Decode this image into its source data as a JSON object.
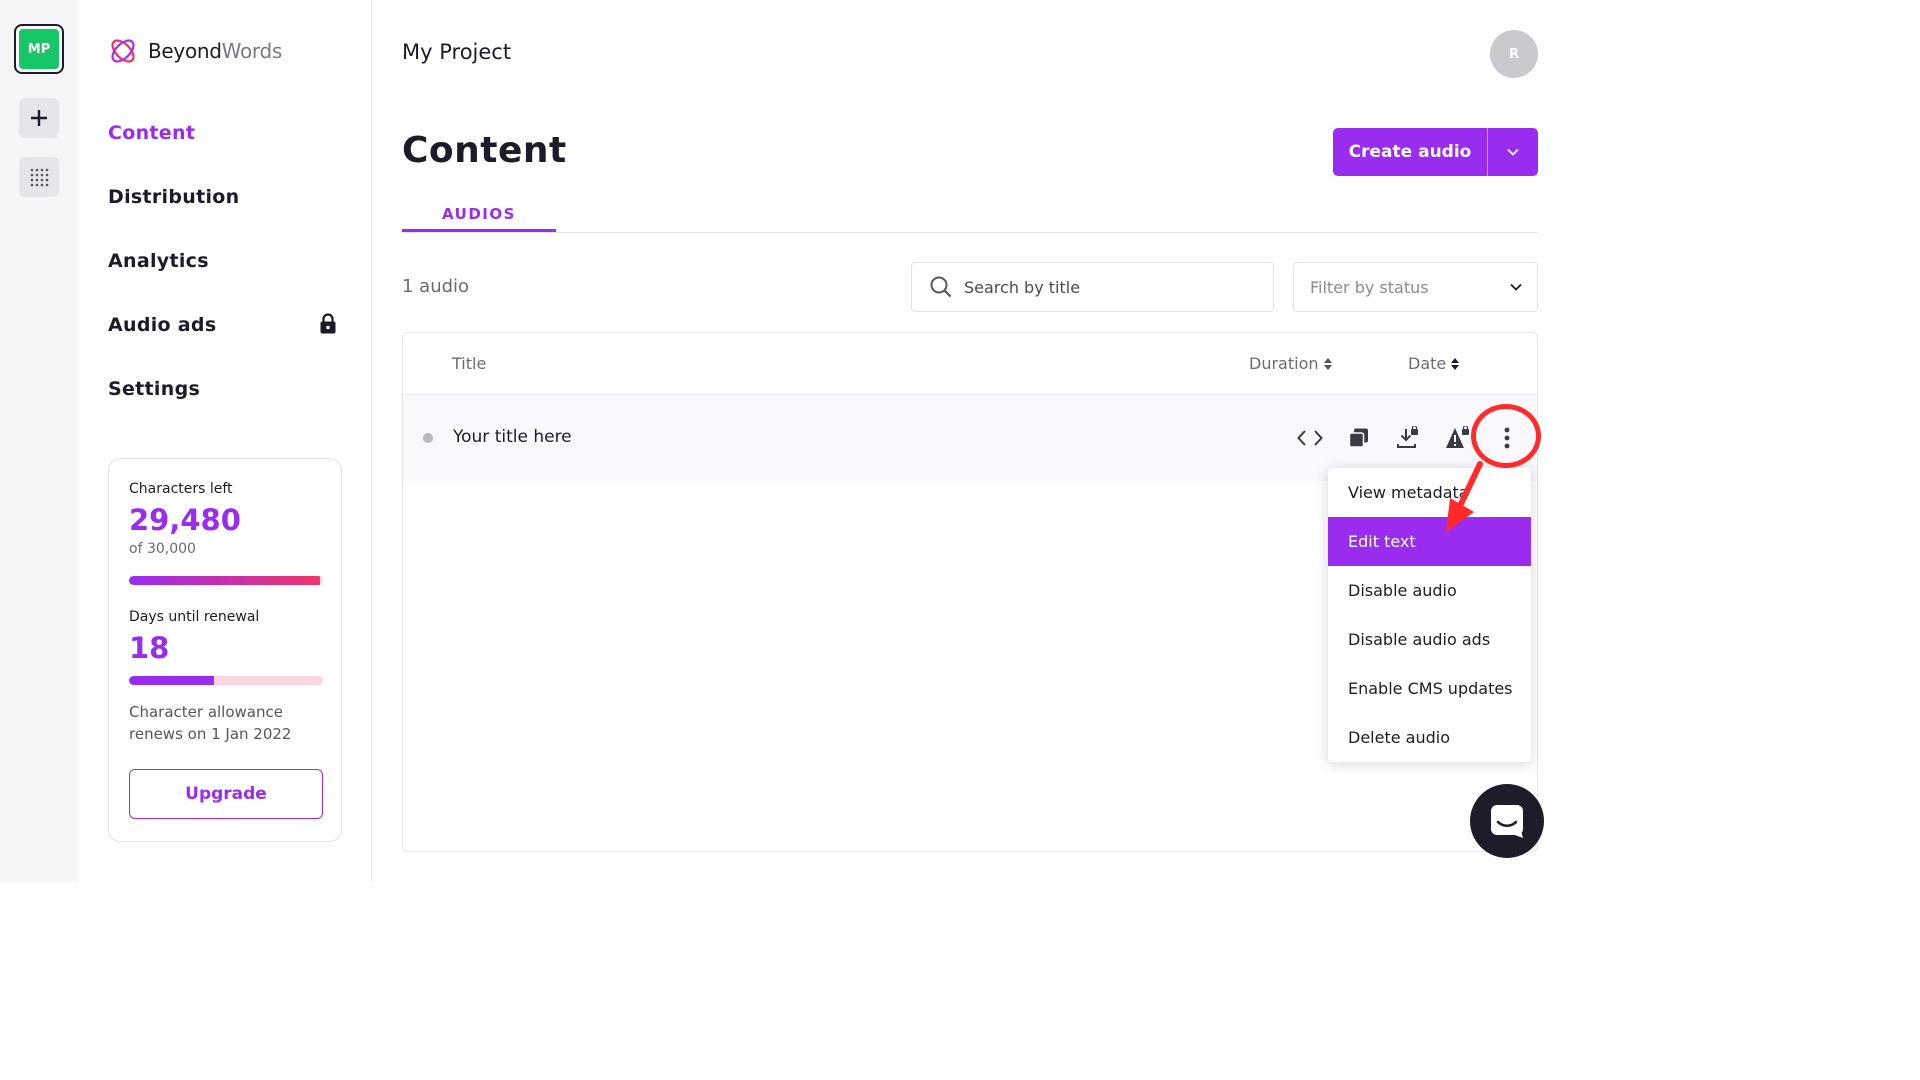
{
  "rail": {
    "workspace_initials": "MP",
    "add_icon": "plus-icon",
    "apps_icon": "grid-icon"
  },
  "brand": {
    "name_bold": "Beyond",
    "name_light": "Words"
  },
  "nav": {
    "items": [
      {
        "label": "Content",
        "active": true
      },
      {
        "label": "Distribution"
      },
      {
        "label": "Analytics"
      },
      {
        "label": "Audio ads",
        "locked": true
      },
      {
        "label": "Settings"
      }
    ]
  },
  "usage": {
    "chars_label": "Characters left",
    "chars_value": "29,480",
    "chars_total": "of 30,000",
    "chars_fraction": 0.983,
    "days_label": "Days until renewal",
    "days_value": "18",
    "days_fraction": 0.44,
    "renew_text": "Character allowance renews on 1 Jan 2022",
    "upgrade_label": "Upgrade"
  },
  "header": {
    "project": "My Project",
    "user_initial": "R"
  },
  "page": {
    "title": "Content",
    "create_label": "Create audio"
  },
  "tabs": [
    {
      "label": "AUDIOS",
      "active": true
    }
  ],
  "toolbar": {
    "count": "1 audio",
    "search_placeholder": "Search by title",
    "filter_placeholder": "Filter by status"
  },
  "table": {
    "columns": {
      "title": "Title",
      "duration": "Duration",
      "date": "Date"
    },
    "rows": [
      {
        "title": "Your title here"
      }
    ]
  },
  "menu": {
    "items": [
      {
        "label": "View metadata"
      },
      {
        "label": "Edit text",
        "highlighted": true
      },
      {
        "label": "Disable audio"
      },
      {
        "label": "Disable audio ads"
      },
      {
        "label": "Enable CMS updates"
      },
      {
        "label": "Delete audio"
      }
    ]
  },
  "colors": {
    "accent": "#9a2cf0",
    "annotation": "#ff2a2a",
    "workspace": "#16c768"
  }
}
